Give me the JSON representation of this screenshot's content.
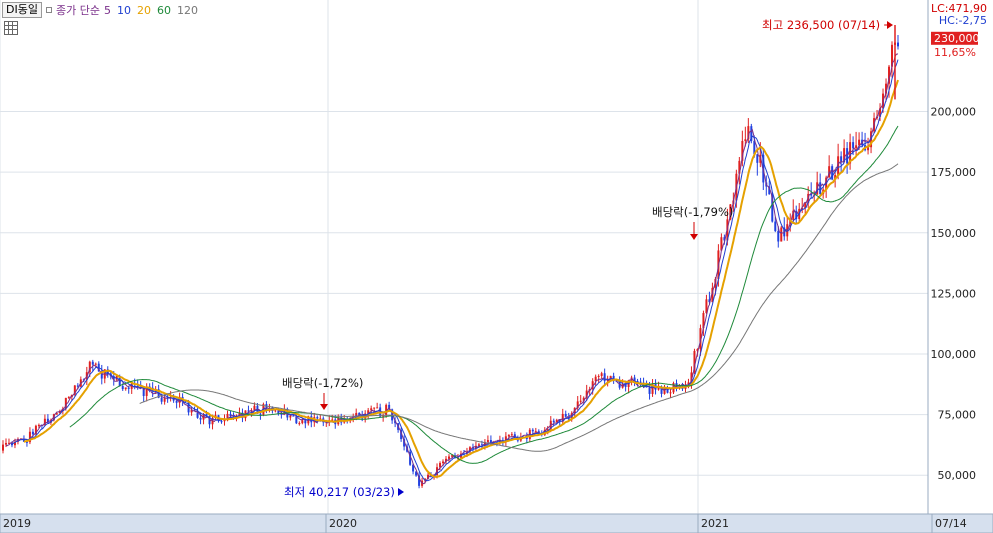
{
  "header": {
    "stock_name": "DI동일",
    "ma_label": "종가 단순",
    "ma_periods": [
      {
        "label": "5",
        "color": "#7a2f8a"
      },
      {
        "label": "10",
        "color": "#1f3fd0"
      },
      {
        "label": "20",
        "color": "#e5a100"
      },
      {
        "label": "60",
        "color": "#1f8a3a"
      },
      {
        "label": "120",
        "color": "#777777"
      }
    ]
  },
  "info": {
    "lc": "LC:471,90",
    "hc": "HC:-2,75",
    "current_price": "230,000",
    "change_pct": "11,65%"
  },
  "chart_data": {
    "type": "candlestick",
    "x_axis_labels": [
      "2019",
      "2020",
      "2021",
      "07/14"
    ],
    "y_ticks": [
      50000,
      75000,
      100000,
      125000,
      150000,
      175000,
      200000
    ],
    "y_tick_labels": [
      "50,000",
      "75,000",
      "100,000",
      "125,000",
      "150,000",
      "175,000",
      "200,000"
    ],
    "ylim": [
      34000,
      246000
    ],
    "grid": true,
    "close_series_points": [
      [
        "2019-01",
        62000
      ],
      [
        "2019-02",
        66000
      ],
      [
        "2019-03",
        78000
      ],
      [
        "2019-04",
        95000
      ],
      [
        "2019-05",
        88000
      ],
      [
        "2019-06",
        84000
      ],
      [
        "2019-07",
        80000
      ],
      [
        "2019-08",
        72000
      ],
      [
        "2019-09",
        75000
      ],
      [
        "2019-10",
        78000
      ],
      [
        "2019-11",
        73000
      ],
      [
        "2019-12",
        71000
      ],
      [
        "2020-01",
        75000
      ],
      [
        "2020-02",
        77000
      ],
      [
        "2020-03",
        46000
      ],
      [
        "2020-04",
        57000
      ],
      [
        "2020-05",
        62000
      ],
      [
        "2020-06",
        65000
      ],
      [
        "2020-07",
        68000
      ],
      [
        "2020-08",
        75000
      ],
      [
        "2020-09",
        90000
      ],
      [
        "2020-10",
        88000
      ],
      [
        "2020-11",
        85000
      ],
      [
        "2020-12",
        88000
      ],
      [
        "2021-01",
        140000
      ],
      [
        "2021-02",
        195000
      ],
      [
        "2021-03",
        150000
      ],
      [
        "2021-04",
        165000
      ],
      [
        "2021-05",
        180000
      ],
      [
        "2021-06",
        190000
      ],
      [
        "2021-07",
        230000
      ]
    ],
    "annotations": [
      {
        "text": "배당락(-1,72%)",
        "date": "2019-12",
        "price": 75000,
        "color": "#d00000"
      },
      {
        "text": "배당락(-1,79%)",
        "date": "2020-12",
        "price": 148000,
        "color": "#d00000"
      },
      {
        "text": "최저 40,217 (03/23)",
        "date": "2020-03",
        "price": 40217,
        "color": "#0000cc"
      },
      {
        "text": "최고 236,500 (07/14)",
        "date": "2021-07",
        "price": 236500,
        "color": "#d00000"
      }
    ]
  }
}
